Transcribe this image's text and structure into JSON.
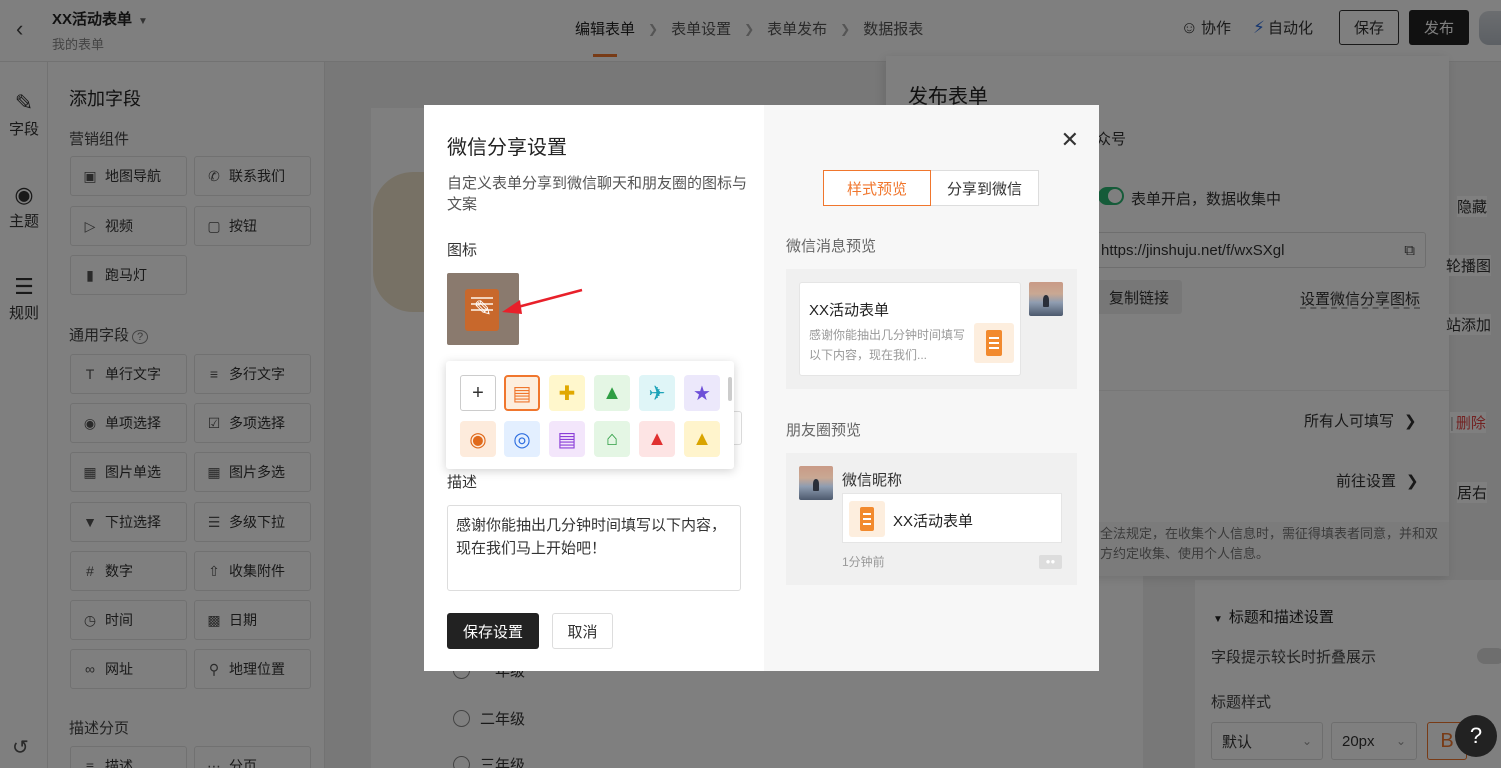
{
  "topbar": {
    "form_name": "XX活动表单",
    "form_sub": "我的表单",
    "steps": [
      "编辑表单",
      "表单设置",
      "表单发布",
      "数据报表"
    ],
    "collab": "协作",
    "automation": "自动化",
    "save": "保存",
    "publish": "发布"
  },
  "rail": {
    "fields": "字段",
    "theme": "主题",
    "rules": "规则"
  },
  "fields_panel": {
    "title": "添加字段",
    "marketing_title": "营销组件",
    "marketing": [
      "地图导航",
      "联系我们",
      "视频",
      "按钮",
      "跑马灯"
    ],
    "general_title": "通用字段",
    "general": [
      "单行文字",
      "多行文字",
      "单项选择",
      "多项选择",
      "图片单选",
      "图片多选",
      "下拉选择",
      "多级下拉",
      "数字",
      "收集附件",
      "时间",
      "日期",
      "网址",
      "地理位置"
    ],
    "desc_title": "描述分页",
    "desc_items": [
      "描述",
      "分页"
    ]
  },
  "canvas": {
    "options": [
      "一年级",
      "二年级",
      "三年级"
    ]
  },
  "drawer": {
    "title": "发布表单",
    "official_account": "众号",
    "status_text": "表单开启，数据收集中",
    "url": "https://jinshuju.net/f/wxSXgl",
    "copy": "复制链接",
    "share_icon_link": "设置微信分享图标",
    "who_can_fill": "所有人可填写",
    "goto_settings": "前往设置",
    "note": "全法规定，在收集个人信息时，需征得填表者同意，并和双方约定收集、使用个人信息。",
    "side_hide": "隐藏",
    "side_carousel": "轮播图",
    "side_add": "站添加",
    "side_delete": "删除",
    "side_left": "居右"
  },
  "rpanel": {
    "collapse_title": "标题和描述设置",
    "fold_label": "字段提示较长时折叠展示",
    "title_style": "标题样式",
    "style_value": "默认",
    "size_value": "20px",
    "bold": "B"
  },
  "modal": {
    "title": "微信分享设置",
    "desc": "自定义表单分享到微信聊天和朋友圈的图标与文案",
    "icon_label": "图标",
    "desc_label": "描述",
    "desc_value": "感谢你能抽出几分钟时间填写以下内容，现在我们马上开始吧！",
    "save": "保存设置",
    "cancel": "取消",
    "tabs": [
      "样式预览",
      "分享到微信"
    ],
    "msg_preview": "微信消息预览",
    "msg_title": "XX活动表单",
    "msg_desc": "感谢你能抽出几分钟时间填写以下内容，现在我们...",
    "moments_preview": "朋友圈预览",
    "nickname": "微信昵称",
    "moments_title": "XX活动表单",
    "moments_time": "1分钟前",
    "picker_icons": [
      "document-icon",
      "medicine-box-icon",
      "tree-icon",
      "airplane-icon",
      "runner-icon",
      "basketball-icon",
      "coin-icon",
      "chart-icon",
      "house-icon",
      "tshirt-icon",
      "graduation-cap-icon"
    ]
  },
  "colors": {
    "accent": "#f0762d",
    "dark": "#222222",
    "switch": "#2bb673"
  }
}
